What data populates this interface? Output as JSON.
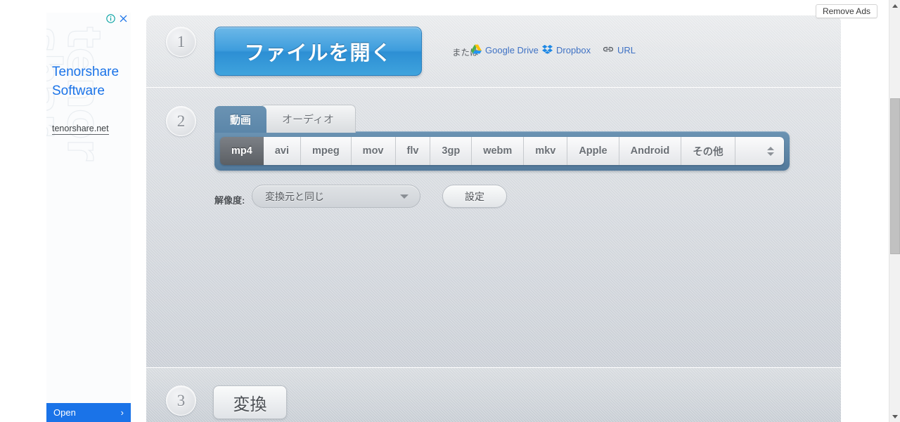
{
  "browser": {
    "remove_ads_label": "Remove Ads"
  },
  "ad": {
    "info_icon": "info-icon",
    "close_icon": "close-icon",
    "title": "Tenorshare Software",
    "display_url": "tenorshare.net",
    "watermark_text": "tenorshare.net",
    "cta_label": "Open",
    "cta_arrow": "›",
    "brand_color": "#1a73e8"
  },
  "app": {
    "sections": [
      {
        "step": "1",
        "open_file_label": "ファイルを開く",
        "or_label": "または",
        "links": [
          {
            "icon": "google-drive-icon",
            "label": "Google Drive"
          },
          {
            "icon": "dropbox-icon",
            "label": "Dropbox"
          },
          {
            "icon": "link-icon",
            "label": "URL"
          }
        ]
      },
      {
        "step": "2",
        "tabs": [
          {
            "label": "動画",
            "active": true
          },
          {
            "label": "オーディオ",
            "active": false
          }
        ],
        "formats": [
          {
            "label": "mp4",
            "selected": true
          },
          {
            "label": "avi",
            "selected": false
          },
          {
            "label": "mpeg",
            "selected": false
          },
          {
            "label": "mov",
            "selected": false
          },
          {
            "label": "flv",
            "selected": false
          },
          {
            "label": "3gp",
            "selected": false
          },
          {
            "label": "webm",
            "selected": false
          },
          {
            "label": "mkv",
            "selected": false
          },
          {
            "label": "Apple",
            "selected": false
          },
          {
            "label": "Android",
            "selected": false
          },
          {
            "label": "その他",
            "selected": false
          }
        ],
        "spinner_icon": "up-down-spinner-icon",
        "resolution_label": "解像度:",
        "resolution_value": "変換元と同じ",
        "resolution_caret_icon": "caret-down-icon",
        "settings_label": "設定"
      },
      {
        "step": "3",
        "convert_label": "変換"
      }
    ],
    "accent_blue": "#3e9ddd",
    "tab_blue": "#5b86a9",
    "link_blue": "#3f72c4"
  },
  "scrollbar": {
    "up_icon": "scroll-up-arrow-icon",
    "down_icon": "scroll-down-arrow-icon",
    "thumb": "scroll-thumb"
  }
}
